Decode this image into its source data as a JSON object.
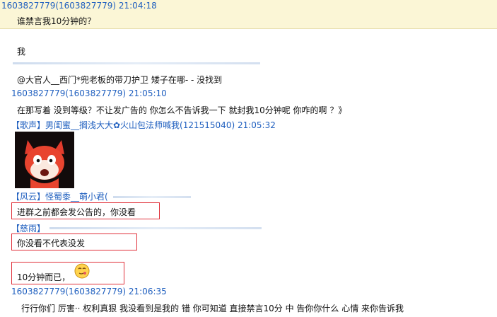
{
  "messages": [
    {
      "sender": "1603827779(1603827779) 21:04:18",
      "text": "谁禁言我10分钟的？"
    },
    {
      "text": "我"
    },
    {
      "text": "@大官人__西门*兜老板的带刀护卫  矮子在哪- -   没找到"
    },
    {
      "sender": "1603827779(1603827779) 21:05:10",
      "text": "在那写着 没到等级？不让发广告的 你怎么不告诉我一下 就封我10分钟呢 你咋的啊 ？》"
    },
    {
      "sender": "【歌声】男闺蜜__搁浅大大✿火山包法师喊我(121515040) 21:05:32"
    },
    {
      "sender": "【风云】怪蜀黍__萌小君(",
      "text": "进群之前都会发公告的，你没看"
    },
    {
      "sender": "【慈雨】",
      "text": "你没看不代表没发"
    },
    {
      "text": "10分钟而已，"
    },
    {
      "sender": "1603827779(1603827779) 21:06:35",
      "text": "行行你们 厉害·· 权利真狠  我没看到是我的 错 你可知道 直接禁言10分 中 告你你什么 心情 来你告诉我"
    }
  ]
}
